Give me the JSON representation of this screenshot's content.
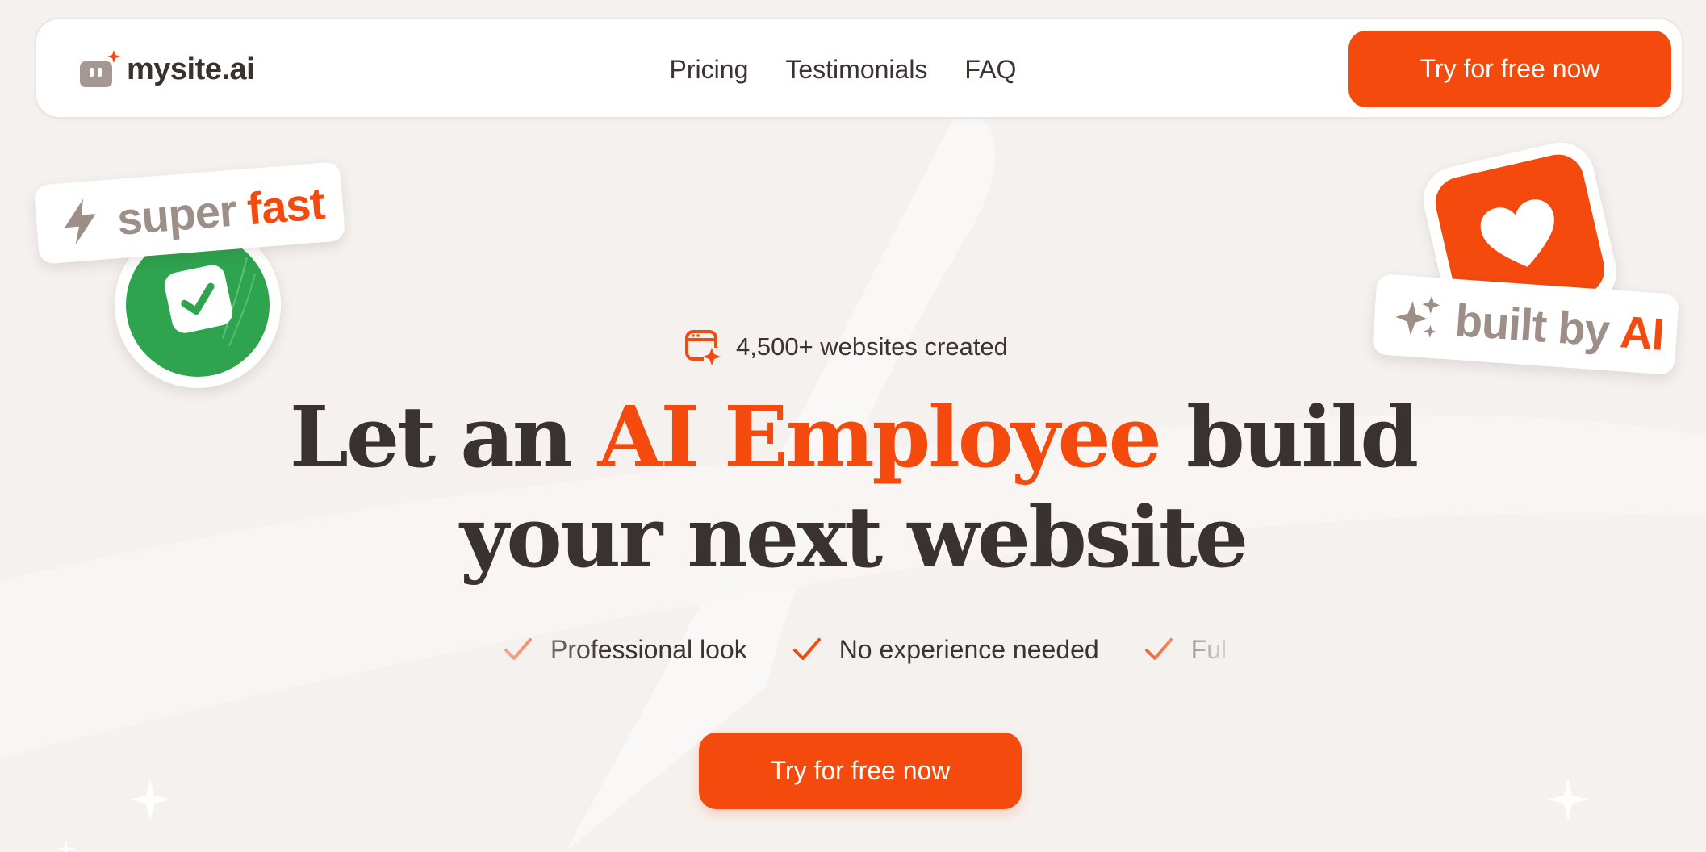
{
  "brand": {
    "name": "mysite.ai",
    "accent_color": "#f44a0d"
  },
  "nav": {
    "links": [
      "Pricing",
      "Testimonials",
      "FAQ"
    ],
    "cta_label": "Try for free now"
  },
  "stickers": {
    "fast": {
      "word1": "super",
      "word2": "fast",
      "icon": "lightning-icon"
    },
    "check": {
      "icon": "check-icon"
    },
    "heart": {
      "icon": "heart-icon"
    },
    "ai": {
      "word1": "built by",
      "word2": "AI",
      "icon": "sparkles-icon"
    }
  },
  "hero": {
    "badge": {
      "icon": "browser-sparkle-icon",
      "text": "4,500+ websites created"
    },
    "headline": {
      "part1": "Let an ",
      "accent": "AI Employee",
      "part2": " build",
      "line2": "your next website"
    },
    "features": [
      "Professional look",
      "No experience needed",
      "Ful"
    ],
    "cta_label": "Try for free now"
  }
}
